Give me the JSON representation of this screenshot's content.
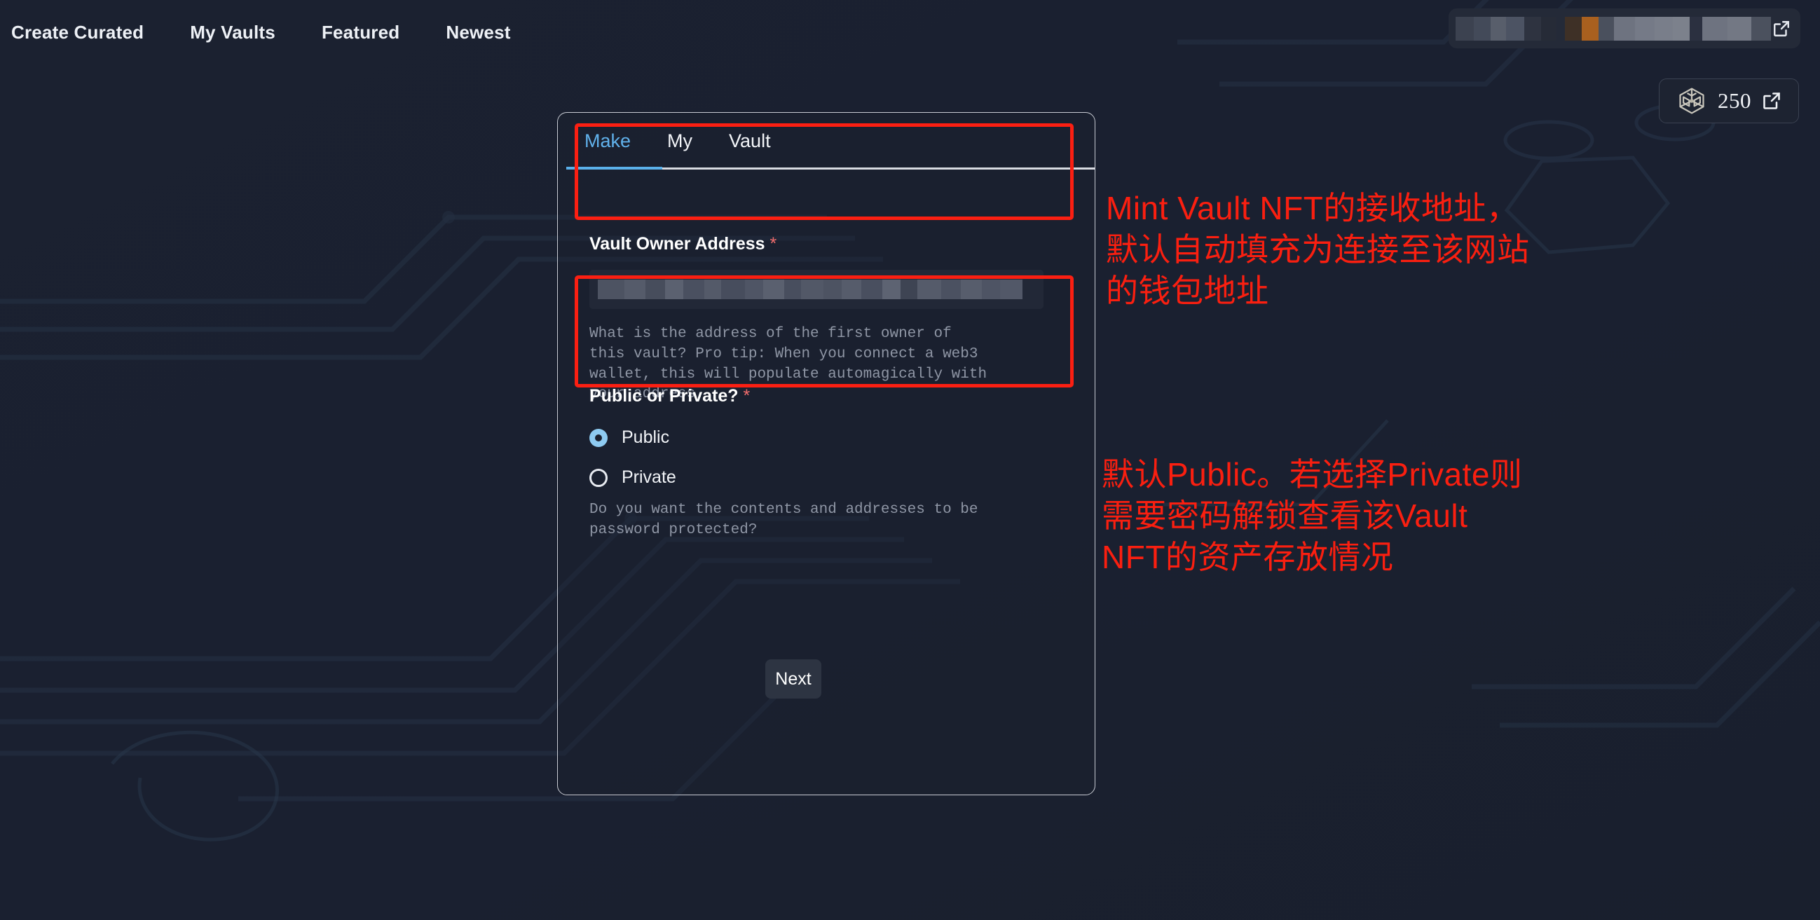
{
  "theme": {
    "page_bg": "#1b2130",
    "accent_blue": "#5ab0ea",
    "annotation_red": "#fa1f10",
    "highlight_box_red": "#fb1f12",
    "card_border": "#c9ccd4",
    "required_star": "#f26d6d"
  },
  "topnav": {
    "items": [
      {
        "label": "Create Curated",
        "name": "nav-create-curated"
      },
      {
        "label": "My Vaults",
        "name": "nav-my-vaults"
      },
      {
        "label": "Featured",
        "name": "nav-featured"
      },
      {
        "label": "Newest",
        "name": "nav-newest"
      }
    ]
  },
  "wallet": {
    "address_redacted": "",
    "expand_icon": "external-link-icon"
  },
  "credits": {
    "count": "250",
    "cube_icon": "3d-cube-icon",
    "link_icon": "external-link-icon"
  },
  "card": {
    "tabs": [
      {
        "label": "Make",
        "active": true
      },
      {
        "label": "My",
        "active": false
      },
      {
        "label": "Vault",
        "active": false
      }
    ],
    "owner_field": {
      "label": "Vault Owner Address",
      "required_marker": "*",
      "value_redacted": "",
      "placeholder": "",
      "helper": "What is the address of the first owner of\nthis vault? Pro tip: When you connect a web3\nwallet, this will populate automagically with\nyour address."
    },
    "visibility_field": {
      "label": "Public or Private?",
      "required_marker": "*",
      "options": [
        {
          "label": "Public",
          "selected": true
        },
        {
          "label": "Private",
          "selected": false
        }
      ],
      "helper": "Do you want the contents and addresses to be\npassword protected?"
    },
    "next_button": "Next"
  },
  "annotations": {
    "owner": "Mint Vault NFT的接收地址，\n默认自动填充为连接至该网站\n的钱包地址",
    "visibility": "默认Public。若选择Private则\n需要密码解锁查看该Vault\nNFT的资产存放情况"
  }
}
